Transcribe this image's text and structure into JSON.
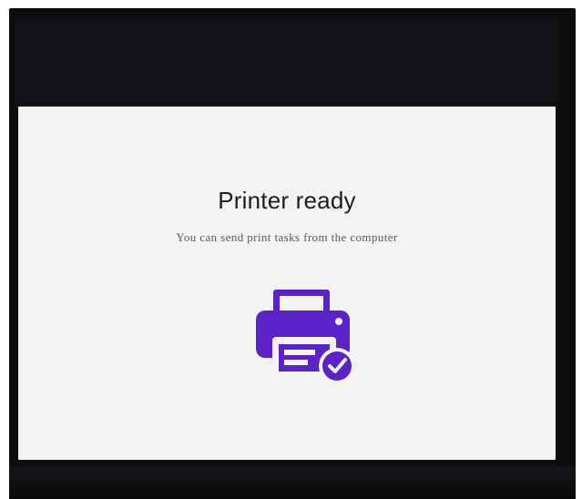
{
  "screen": {
    "title": "Printer ready",
    "subtitle": "You can send print tasks from the computer",
    "icon": "printer-ready-icon",
    "accent_color": "#5b22c8"
  }
}
